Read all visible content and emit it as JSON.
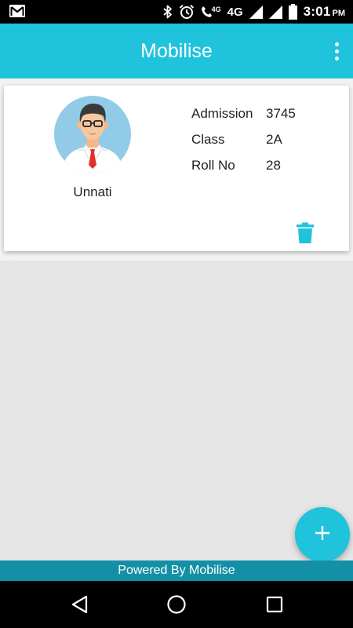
{
  "status_bar": {
    "icons": [
      "gmail-icon",
      "bluetooth-icon",
      "alarm-icon",
      "volte-call-icon",
      "signal-icon",
      "signal-icon",
      "battery-icon"
    ],
    "call_network": "4G",
    "network": "4G",
    "time": "3:01",
    "time_suffix": "PM"
  },
  "app_bar": {
    "title": "Mobilise",
    "menu_icon": "overflow-menu-icon"
  },
  "students": [
    {
      "name": "Unnati",
      "avatar_icon": "student-avatar-icon",
      "fields": [
        {
          "label": "Admission",
          "value": "3745"
        },
        {
          "label": "Class",
          "value": "2A"
        },
        {
          "label": "Roll No",
          "value": "28"
        }
      ],
      "delete_icon": "trash-icon"
    }
  ],
  "fab": {
    "icon": "plus-icon"
  },
  "footer": {
    "text": "Powered By Mobilise"
  },
  "nav_bar": {
    "icons": [
      "back-icon",
      "home-icon",
      "recents-icon"
    ]
  },
  "colors": {
    "primary": "#1fc3dc",
    "footer": "#1490a6",
    "background": "#e5e5e5",
    "status_bar": "#000000"
  }
}
